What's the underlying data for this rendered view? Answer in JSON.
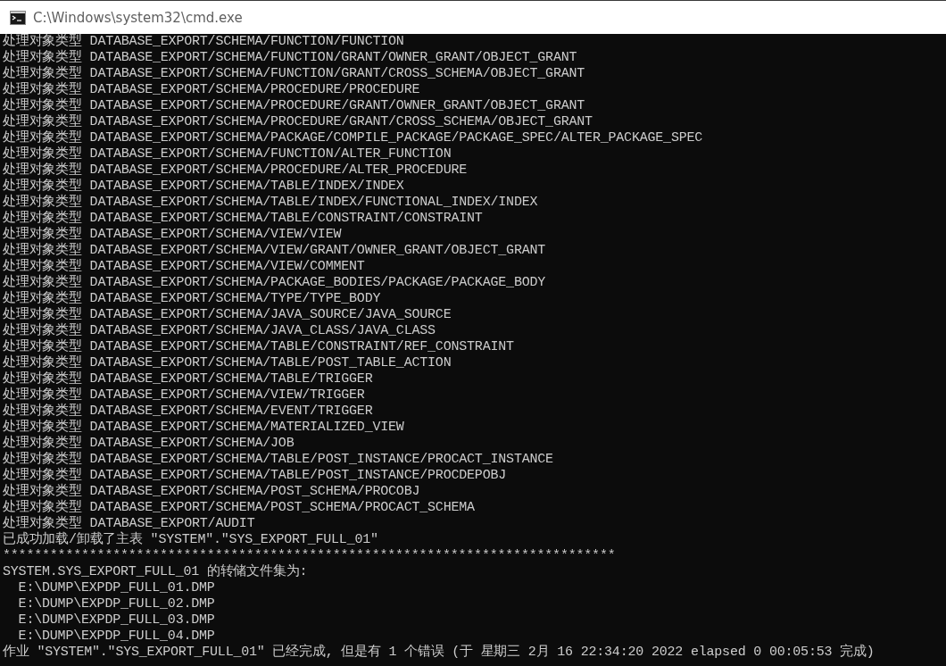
{
  "window": {
    "title": "C:\\Windows\\system32\\cmd.exe"
  },
  "console_lines": [
    "处理对象类型 DATABASE_EXPORT/SCHEMA/FUNCTION/FUNCTION",
    "处理对象类型 DATABASE_EXPORT/SCHEMA/FUNCTION/GRANT/OWNER_GRANT/OBJECT_GRANT",
    "处理对象类型 DATABASE_EXPORT/SCHEMA/FUNCTION/GRANT/CROSS_SCHEMA/OBJECT_GRANT",
    "处理对象类型 DATABASE_EXPORT/SCHEMA/PROCEDURE/PROCEDURE",
    "处理对象类型 DATABASE_EXPORT/SCHEMA/PROCEDURE/GRANT/OWNER_GRANT/OBJECT_GRANT",
    "处理对象类型 DATABASE_EXPORT/SCHEMA/PROCEDURE/GRANT/CROSS_SCHEMA/OBJECT_GRANT",
    "处理对象类型 DATABASE_EXPORT/SCHEMA/PACKAGE/COMPILE_PACKAGE/PACKAGE_SPEC/ALTER_PACKAGE_SPEC",
    "处理对象类型 DATABASE_EXPORT/SCHEMA/FUNCTION/ALTER_FUNCTION",
    "处理对象类型 DATABASE_EXPORT/SCHEMA/PROCEDURE/ALTER_PROCEDURE",
    "处理对象类型 DATABASE_EXPORT/SCHEMA/TABLE/INDEX/INDEX",
    "处理对象类型 DATABASE_EXPORT/SCHEMA/TABLE/INDEX/FUNCTIONAL_INDEX/INDEX",
    "处理对象类型 DATABASE_EXPORT/SCHEMA/TABLE/CONSTRAINT/CONSTRAINT",
    "处理对象类型 DATABASE_EXPORT/SCHEMA/VIEW/VIEW",
    "处理对象类型 DATABASE_EXPORT/SCHEMA/VIEW/GRANT/OWNER_GRANT/OBJECT_GRANT",
    "处理对象类型 DATABASE_EXPORT/SCHEMA/VIEW/COMMENT",
    "处理对象类型 DATABASE_EXPORT/SCHEMA/PACKAGE_BODIES/PACKAGE/PACKAGE_BODY",
    "处理对象类型 DATABASE_EXPORT/SCHEMA/TYPE/TYPE_BODY",
    "处理对象类型 DATABASE_EXPORT/SCHEMA/JAVA_SOURCE/JAVA_SOURCE",
    "处理对象类型 DATABASE_EXPORT/SCHEMA/JAVA_CLASS/JAVA_CLASS",
    "处理对象类型 DATABASE_EXPORT/SCHEMA/TABLE/CONSTRAINT/REF_CONSTRAINT",
    "处理对象类型 DATABASE_EXPORT/SCHEMA/TABLE/POST_TABLE_ACTION",
    "处理对象类型 DATABASE_EXPORT/SCHEMA/TABLE/TRIGGER",
    "处理对象类型 DATABASE_EXPORT/SCHEMA/VIEW/TRIGGER",
    "处理对象类型 DATABASE_EXPORT/SCHEMA/EVENT/TRIGGER",
    "处理对象类型 DATABASE_EXPORT/SCHEMA/MATERIALIZED_VIEW",
    "处理对象类型 DATABASE_EXPORT/SCHEMA/JOB",
    "处理对象类型 DATABASE_EXPORT/SCHEMA/TABLE/POST_INSTANCE/PROCACT_INSTANCE",
    "处理对象类型 DATABASE_EXPORT/SCHEMA/TABLE/POST_INSTANCE/PROCDEPOBJ",
    "处理对象类型 DATABASE_EXPORT/SCHEMA/POST_SCHEMA/PROCOBJ",
    "处理对象类型 DATABASE_EXPORT/SCHEMA/POST_SCHEMA/PROCACT_SCHEMA",
    "处理对象类型 DATABASE_EXPORT/AUDIT",
    "已成功加载/卸载了主表 \"SYSTEM\".\"SYS_EXPORT_FULL_01\"",
    "******************************************************************************",
    "SYSTEM.SYS_EXPORT_FULL_01 的转储文件集为:",
    "  E:\\DUMP\\EXPDP_FULL_01.DMP",
    "  E:\\DUMP\\EXPDP_FULL_02.DMP",
    "  E:\\DUMP\\EXPDP_FULL_03.DMP",
    "  E:\\DUMP\\EXPDP_FULL_04.DMP",
    "作业 \"SYSTEM\".\"SYS_EXPORT_FULL_01\" 已经完成, 但是有 1 个错误 (于 星期三 2月 16 22:34:20 2022 elapsed 0 00:05:53 完成)"
  ]
}
